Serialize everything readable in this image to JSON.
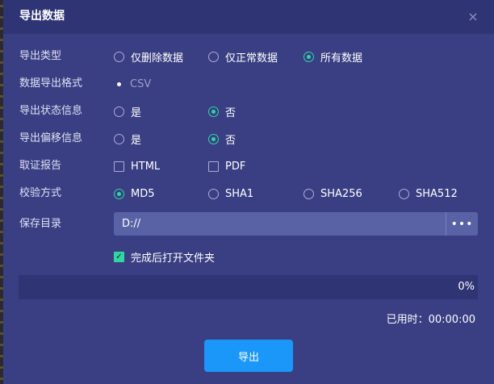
{
  "dialog": {
    "title": "导出数据",
    "close_icon": "close-icon",
    "close_glyph": "×"
  },
  "export_type": {
    "label": "导出类型",
    "options": [
      "仅删除数据",
      "仅正常数据",
      "所有数据"
    ],
    "selected": "所有数据"
  },
  "format": {
    "label": "数据导出格式",
    "value": "CSV"
  },
  "status_info": {
    "label": "导出状态信息",
    "options": [
      "是",
      "否"
    ],
    "selected": "否"
  },
  "offset_info": {
    "label": "导出偏移信息",
    "options": [
      "是",
      "否"
    ],
    "selected": "否"
  },
  "evidence_report": {
    "label": "取证报告",
    "options": [
      "HTML",
      "PDF"
    ],
    "checked": []
  },
  "checksum": {
    "label": "校验方式",
    "options": [
      "MD5",
      "SHA1",
      "SHA256",
      "SHA512"
    ],
    "selected": "MD5"
  },
  "save_dir": {
    "label": "保存目录",
    "value": "D://",
    "browse_label": "•••"
  },
  "open_folder": {
    "label": "完成后打开文件夹",
    "checked": true
  },
  "progress": {
    "value_percent": 0,
    "text": "0%"
  },
  "elapsed": {
    "text": "已用时：00:00:00"
  },
  "export_button": {
    "label": "导出"
  },
  "colors": {
    "dialog_bg": "#3a3f83",
    "header_bg": "#2f3474",
    "accent_green": "#2fd6a0",
    "primary_blue": "#1a97f8"
  }
}
